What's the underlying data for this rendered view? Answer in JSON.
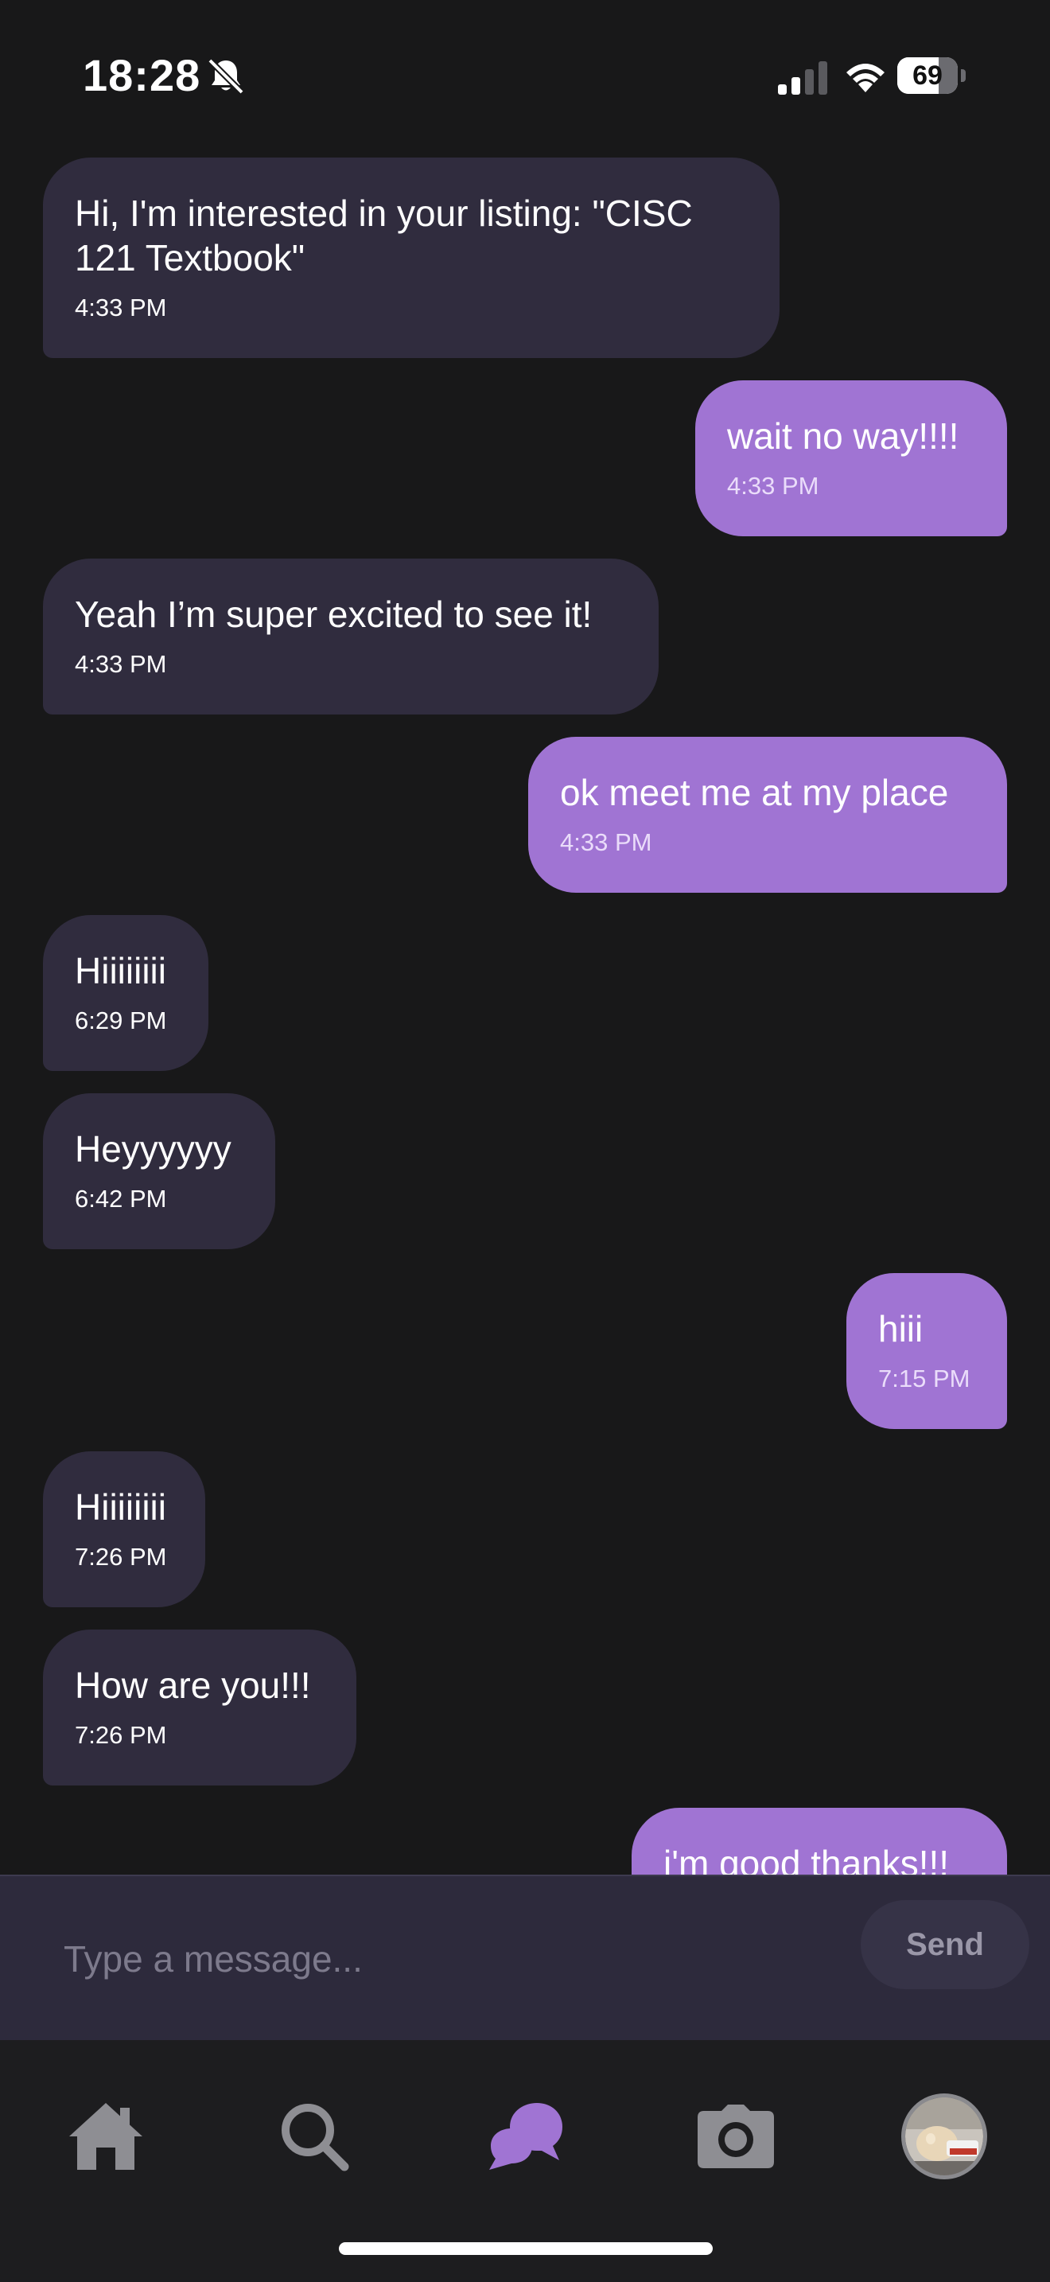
{
  "status_bar": {
    "time": "18:28",
    "battery_percent": "69",
    "battery_level": 0.69
  },
  "messages": [
    {
      "text": "Hi, I'm interested in your listing: \"CISC 121 Textbook\"",
      "time": "4:33 PM",
      "from": "received"
    },
    {
      "text": "wait no way!!!!",
      "time": "4:33 PM",
      "from": "sent"
    },
    {
      "text": "Yeah I’m super excited to see it!",
      "time": "4:33 PM",
      "from": "received"
    },
    {
      "text": "ok meet me at my place",
      "time": "4:33 PM",
      "from": "sent"
    },
    {
      "text": "Hiiiiiiii",
      "time": "6:29 PM",
      "from": "received"
    },
    {
      "text": "Heyyyyyy",
      "time": "6:42 PM",
      "from": "received"
    },
    {
      "text": "hiii",
      "time": "7:15 PM",
      "from": "sent"
    },
    {
      "text": "Hiiiiiiii",
      "time": "7:26 PM",
      "from": "received"
    },
    {
      "text": "How are you!!!",
      "time": "7:26 PM",
      "from": "received"
    },
    {
      "text": "i'm good thanks!!!",
      "time": "",
      "from": "sent"
    }
  ],
  "composer": {
    "placeholder": "Type a message...",
    "send_label": "Send"
  },
  "tab_bar": {
    "items": [
      {
        "icon": "home-icon",
        "active": false
      },
      {
        "icon": "search-icon",
        "active": false
      },
      {
        "icon": "chat-bubbles-icon",
        "active": true
      },
      {
        "icon": "camera-icon",
        "active": false
      },
      {
        "icon": "profile-avatar",
        "active": false
      }
    ],
    "active_color": "#a074d3",
    "inactive_color": "#8e8e93"
  },
  "colors": {
    "background": "#181819",
    "received_bubble": "#302c3e",
    "sent_bubble": "#a074d3",
    "composer_background": "#2d2a3c"
  }
}
